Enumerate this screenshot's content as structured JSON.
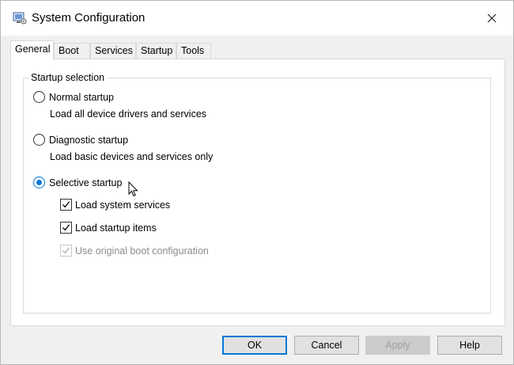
{
  "window": {
    "title": "System Configuration",
    "icon": "system-config-icon",
    "close_icon": "close-icon"
  },
  "tabs": [
    {
      "label": "General",
      "active": true
    },
    {
      "label": "Boot",
      "active": false
    },
    {
      "label": "Services",
      "active": false
    },
    {
      "label": "Startup",
      "active": false
    },
    {
      "label": "Tools",
      "active": false
    }
  ],
  "startup_selection": {
    "legend": "Startup selection",
    "normal": {
      "label": "Normal startup",
      "description": "Load all device drivers and services",
      "selected": false
    },
    "diagnostic": {
      "label": "Diagnostic startup",
      "description": "Load basic devices and services only",
      "selected": false
    },
    "selective": {
      "label": "Selective startup",
      "selected": true
    },
    "options": [
      {
        "label": "Load system services",
        "checked": true,
        "enabled": true
      },
      {
        "label": "Load startup items",
        "checked": true,
        "enabled": true
      },
      {
        "label": "Use original boot configuration",
        "checked": true,
        "enabled": false
      }
    ]
  },
  "buttons": {
    "ok": "OK",
    "cancel": "Cancel",
    "apply": "Apply",
    "help": "Help"
  },
  "colors": {
    "accent": "#0078d7",
    "disabled_text": "#8c8c8c"
  }
}
